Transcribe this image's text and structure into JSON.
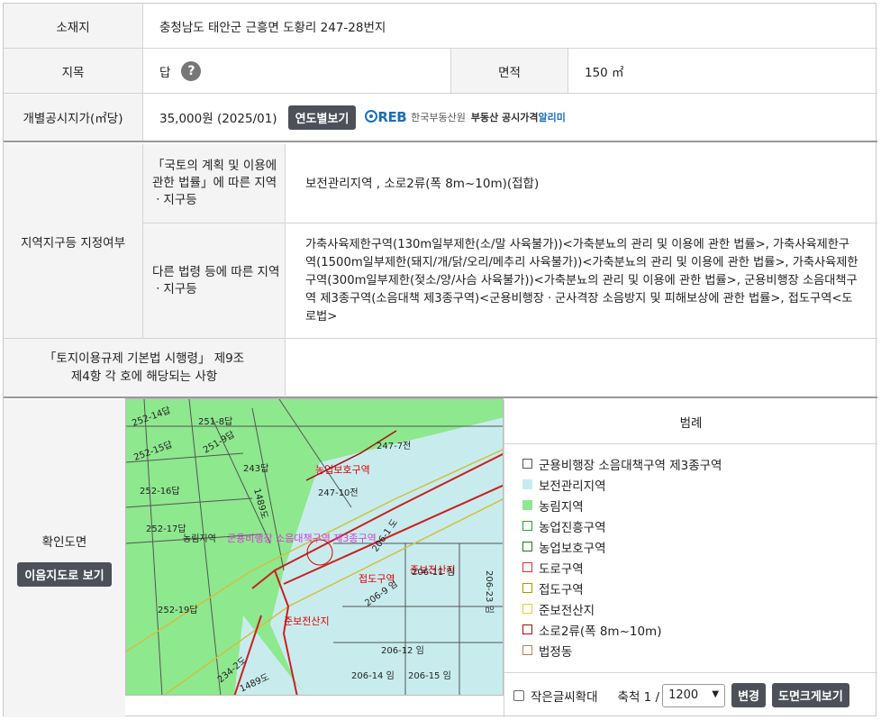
{
  "location": {
    "label": "소재지",
    "value": "충청남도 태안군 근흥면 도황리 247-28번지"
  },
  "land": {
    "label": "지목",
    "value": "답",
    "help_icon": "?",
    "area_label": "면적",
    "area_value": "150 ㎡"
  },
  "price": {
    "label": "개별공시지가(㎡당)",
    "value": "35,000원 (2025/01)",
    "year_button": "연도별보기",
    "reb_logo_mark": "REB",
    "reb_logo_org": "한국부동산원",
    "reb_logo_text1": "부동산 공시가격",
    "reb_logo_text2": "알리미"
  },
  "zoning": {
    "label": "지역지구등 지정여부",
    "national_label": "「국토의 계획 및 이용에 관한 법률」에 따른 지역ㆍ지구등",
    "national_value": "보전관리지역 , 소로2류(폭 8m~10m)(접합)",
    "other_label": "다른 법령 등에 따른 지역ㆍ지구등",
    "other_value": "가축사육제한구역(130m일부제한(소/말 사육불가))<가축분뇨의 관리 및 이용에 관한 법률>, 가축사육제한구역(1500m일부제한(돼지/개/닭/오리/메추리 사육불가))<가축분뇨의 관리 및 이용에 관한 법률>, 가축사육제한구역(300m일부제한(젖소/양/사슴 사육불가))<가축분뇨의 관리 및 이용에 관한 법률>, 군용비행장 소음대책구역 제3종구역(소음대책 제3종구역)<군용비행장ㆍ군사격장 소음방지 및 피해보상에 관한 법률>, 접도구역<도로법>"
  },
  "decree": {
    "label": "「토지이용규제 기본법 시행령」 제9조 제4항 각 호에 해당되는 사항",
    "value": ""
  },
  "map": {
    "label": "확인도면",
    "view_button": "이음지도로 보기",
    "labels": {
      "p251_8": "251-8답",
      "p251_9": "251-9답",
      "p252_14": "252-14답",
      "p252_15": "252-15답",
      "p252_16": "252-16답",
      "p252_17": "252-17답",
      "p252_19": "252-19답",
      "p243": "243답",
      "p247_7": "247-7전",
      "p247_10": "247-10전",
      "forest": "농림지역",
      "agri": "농업보호구역",
      "noise": "군용비행장 소음대책구역 제3종구역",
      "road_buf": "접도구역",
      "semi": "준보전산지",
      "semi2": "준보전산지",
      "p206_11": "206-11 임",
      "p206_23": "206-23 임",
      "p206_12": "206-12 임",
      "p206_14": "206-14 임",
      "p206_15": "206-15 임",
      "p206_9": "206-9 임",
      "p206_1": "206-1 도",
      "road_v": "1489도",
      "p234": "234-2도",
      "p1489": "1489도"
    }
  },
  "legend": {
    "title": "범례",
    "items": [
      {
        "label": "군용비행장 소음대책구역 제3종구역",
        "fill": "#ffffff",
        "border": "#555555"
      },
      {
        "label": "보전관리지역",
        "fill": "#c8ecee",
        "border": "#c8ecee"
      },
      {
        "label": "농림지역",
        "fill": "#8ee88e",
        "border": "#8ee88e"
      },
      {
        "label": "농업진흥구역",
        "fill": "#ffffff",
        "border": "#2aa02a"
      },
      {
        "label": "농업보호구역",
        "fill": "#ffffff",
        "border": "#1a7a1a"
      },
      {
        "label": "도로구역",
        "fill": "#ffffff",
        "border": "#d03030"
      },
      {
        "label": "접도구역",
        "fill": "#ffffff",
        "border": "#a0a000"
      },
      {
        "label": "준보전산지",
        "fill": "#ffffff",
        "border": "#e0d040"
      },
      {
        "label": "소로2류(폭 8m~10m)",
        "fill": "#ffffff",
        "border": "#a01010"
      },
      {
        "label": "법정동",
        "fill": "#ffffff",
        "border": "#b08060"
      }
    ],
    "small_text_label": "작은글씨확대",
    "scale_label": "축척 1 /",
    "scale_value": "1200",
    "change_button": "변경",
    "big_map_button": "도면크게보기"
  }
}
